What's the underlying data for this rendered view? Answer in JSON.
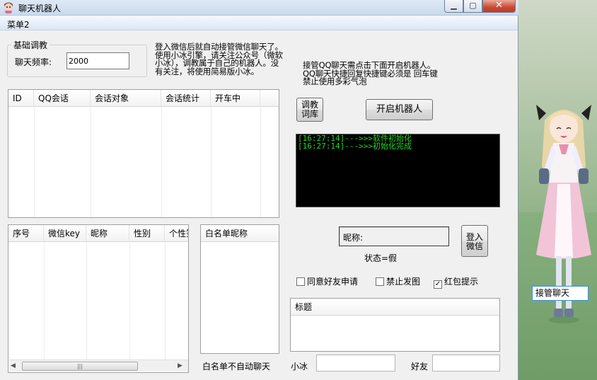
{
  "window": {
    "title": "聊天机器人",
    "menu": [
      "菜单2"
    ]
  },
  "basic_training": {
    "group_title": "基础调教",
    "freq_label": "聊天频率:",
    "freq_value": "2000"
  },
  "notes": {
    "left": "登入微信后就自动接管微信聊天了。\n使用小冰引擎，请关注公众号（微软\n小冰），调教属于自己的机器人。没\n有关注，将使用简易版小冰。",
    "right": "接管QQ聊天需点击下面开启机器人。\nQQ聊天快捷回复快捷键必须是 回车键\n禁止使用多彩气泡"
  },
  "session_table": {
    "columns": [
      "ID",
      "QQ会话",
      "会话对象",
      "会话统计",
      "开车中"
    ],
    "rows": []
  },
  "friend_table": {
    "columns": [
      "序号",
      "微信key",
      "昵称",
      "性别",
      "个性签"
    ],
    "rows": [],
    "scroll_thumb_label": "|||"
  },
  "whitelist": {
    "header": "白名单昵称",
    "caption": "白名单不自动聊天"
  },
  "buttons": {
    "train": "调教\n词库",
    "start": "开启机器人",
    "login": "登入\n微信"
  },
  "console_log": [
    "[16:27:14]--->>>软件初始化",
    "[16:27:14]--->>>初始化完成"
  ],
  "account": {
    "nick_label": "昵称:",
    "status": "状态=假"
  },
  "options": {
    "accept_friend": {
      "label": "同意好友申请",
      "checked": false
    },
    "no_image": {
      "label": "禁止发图",
      "checked": false
    },
    "red_packet": {
      "label": "红包提示",
      "checked": true
    }
  },
  "title_list": {
    "header": "标题"
  },
  "inputs": {
    "xiaobing_label": "小冰",
    "friend_label": "好友"
  },
  "floating": {
    "takeover_label": "接管聊天"
  },
  "colors": {
    "console_bg": "#000000",
    "console_text": "#22d81e",
    "close_button": "#c94a35"
  }
}
